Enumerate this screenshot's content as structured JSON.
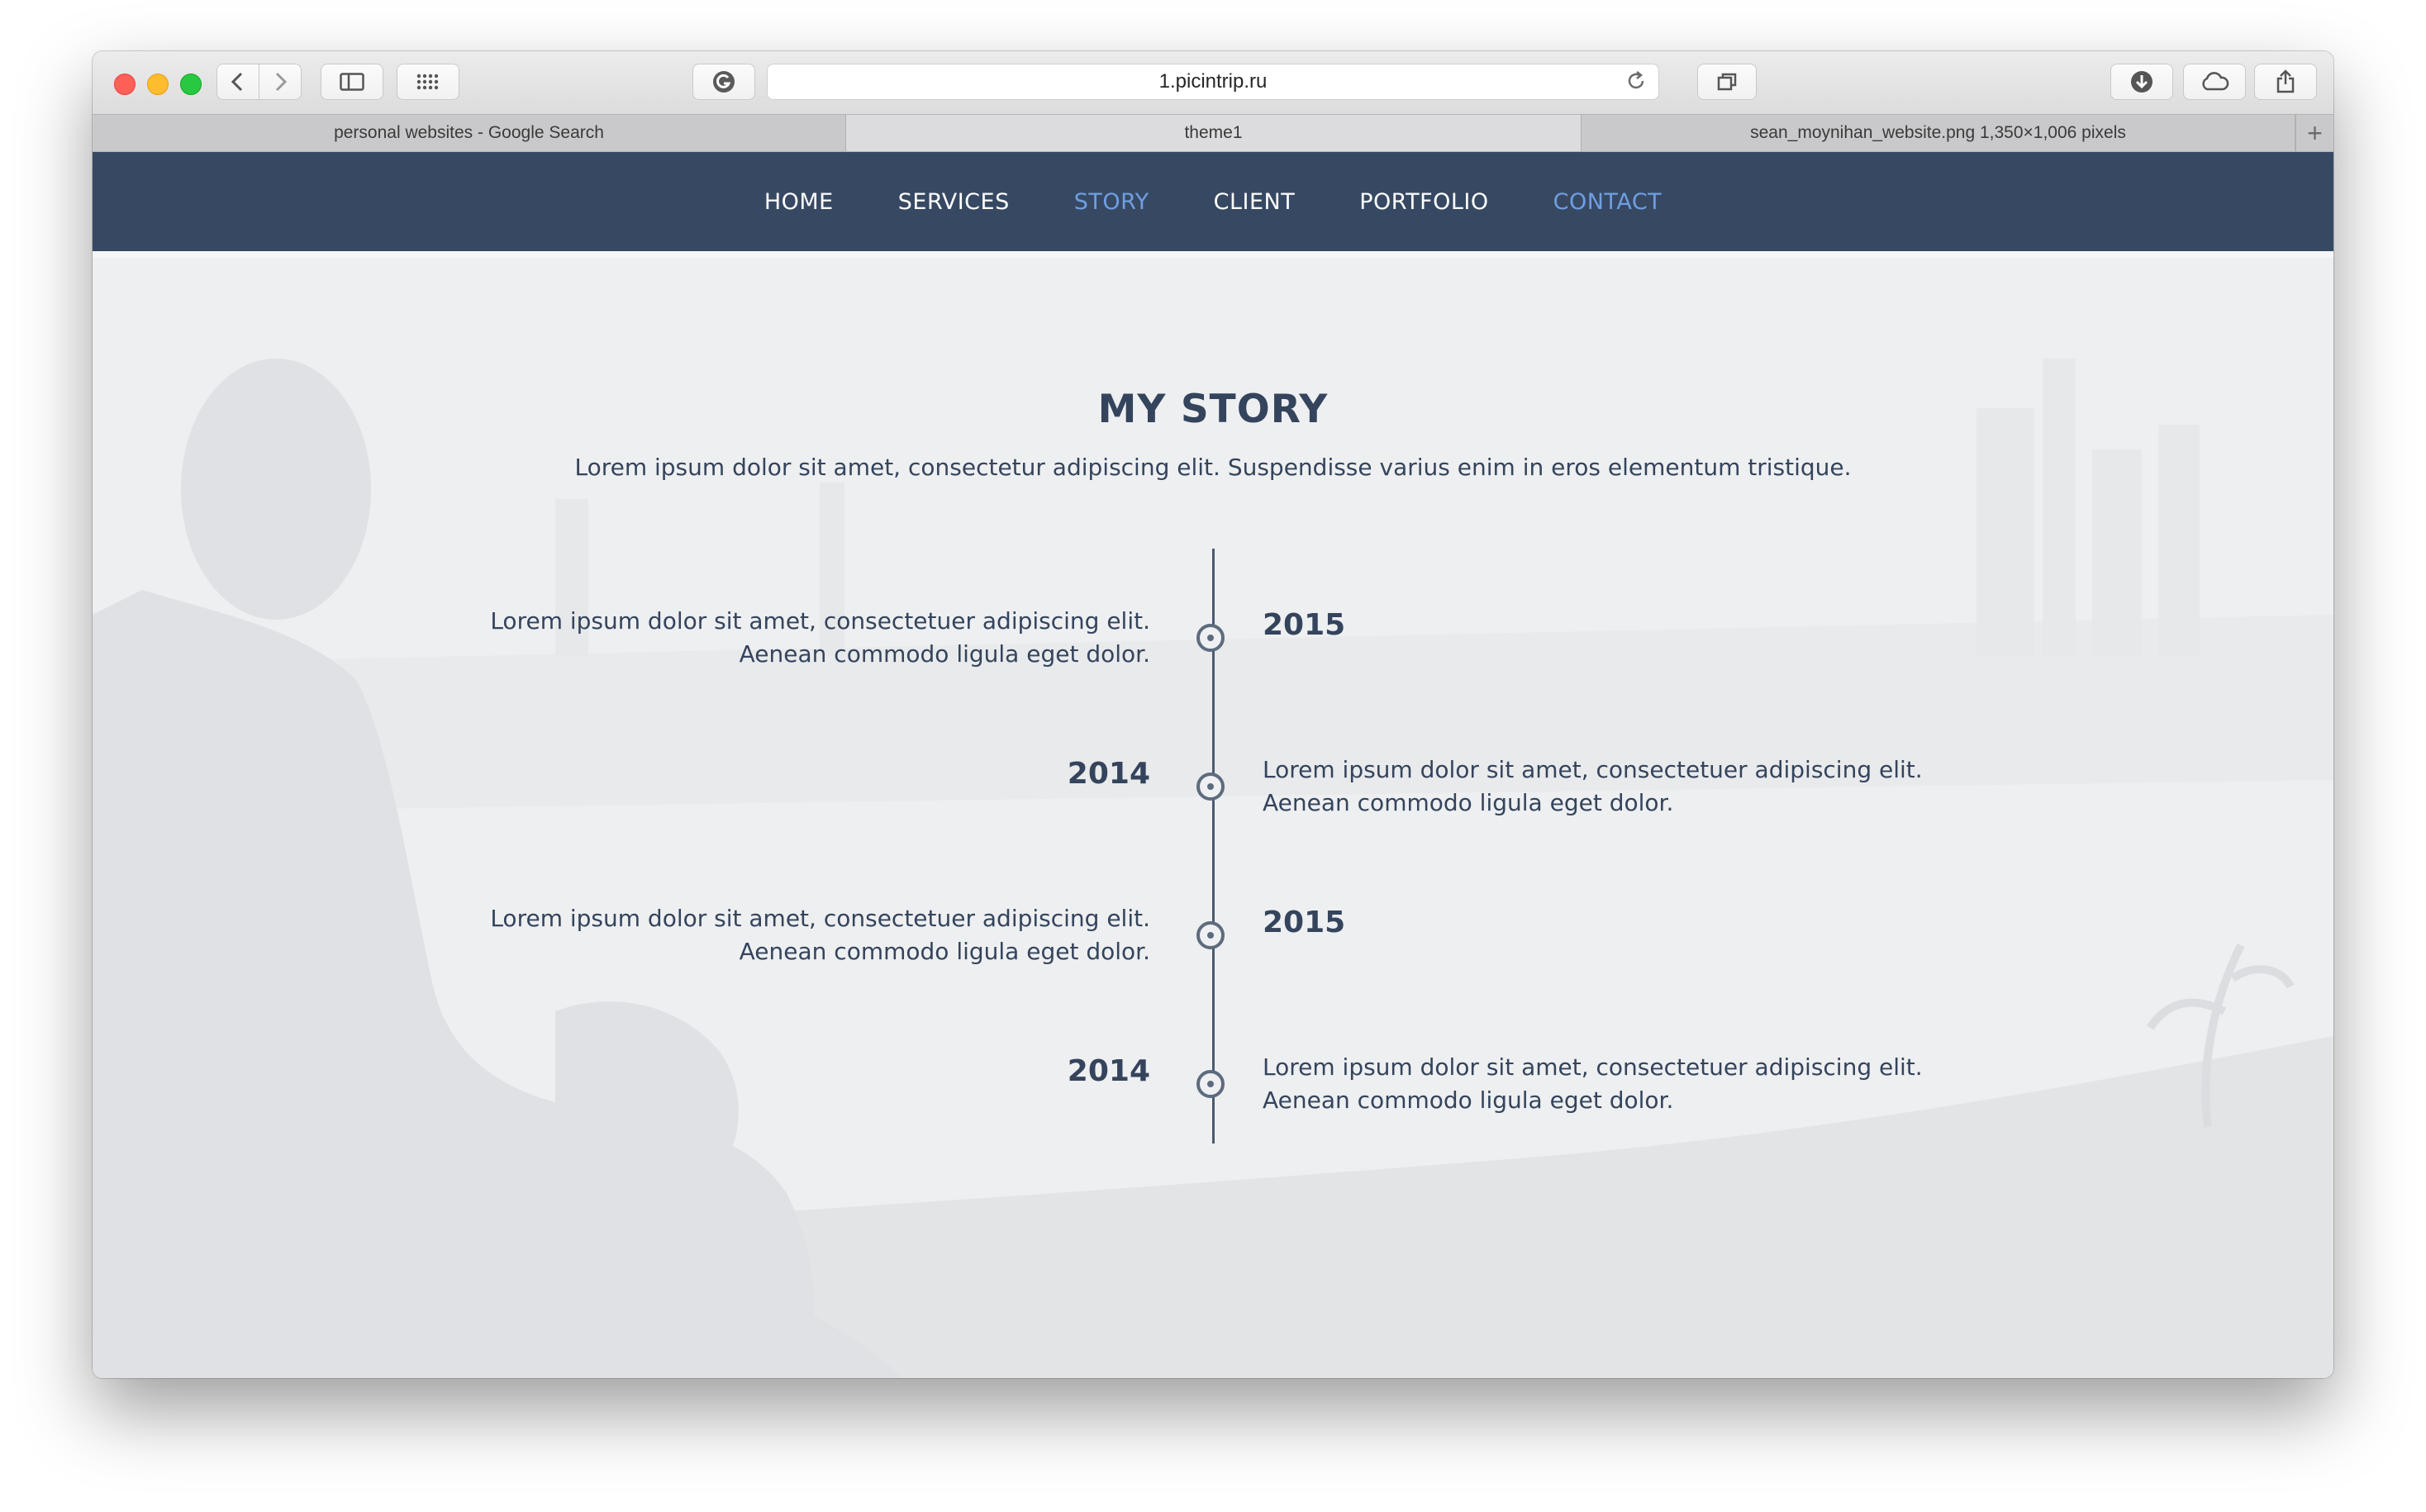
{
  "browser": {
    "url": "1.picintrip.ru",
    "tabs": [
      {
        "label": "personal websites - Google Search"
      },
      {
        "label": "theme1"
      },
      {
        "label": "sean_moynihan_website.png 1,350×1,006 pixels"
      }
    ],
    "icons": [
      "back-icon",
      "forward-icon",
      "sidebar-icon",
      "grid-icon",
      "grammarly-icon",
      "reload-icon",
      "tabs-overview-icon",
      "download-icon",
      "cloud-icon",
      "share-icon",
      "new-tab-icon"
    ]
  },
  "nav": {
    "items": [
      {
        "label": "HOME",
        "highlight": false
      },
      {
        "label": "SERVICES",
        "highlight": false
      },
      {
        "label": "STORY",
        "highlight": true
      },
      {
        "label": "CLIENT",
        "highlight": false
      },
      {
        "label": "PORTFOLIO",
        "highlight": false
      },
      {
        "label": "CONTACT",
        "highlight": true
      }
    ]
  },
  "story": {
    "title": "MY STORY",
    "subtitle": "Lorem ipsum dolor sit amet, consectetur adipiscing elit. Suspendisse varius enim in eros elementum tristique.",
    "entries": [
      {
        "year": "2015",
        "line1": "Lorem ipsum dolor sit amet, consectetuer adipiscing elit.",
        "line2": "Aenean commodo ligula eget dolor."
      },
      {
        "year": "2014",
        "line1": "Lorem ipsum dolor sit amet, consectetuer adipiscing elit.",
        "line2": "Aenean commodo ligula eget dolor."
      },
      {
        "year": "2015",
        "line1": "Lorem ipsum dolor sit amet, consectetuer adipiscing elit.",
        "line2": "Aenean commodo ligula eget dolor."
      },
      {
        "year": "2014",
        "line1": "Lorem ipsum dolor sit amet, consectetuer adipiscing elit.",
        "line2": "Aenean commodo ligula eget dolor."
      }
    ]
  },
  "colors": {
    "navbar": "#374962",
    "nav_highlight": "#6f9fe3",
    "heading_text": "#34445c",
    "page_background": "#eeeff1"
  }
}
